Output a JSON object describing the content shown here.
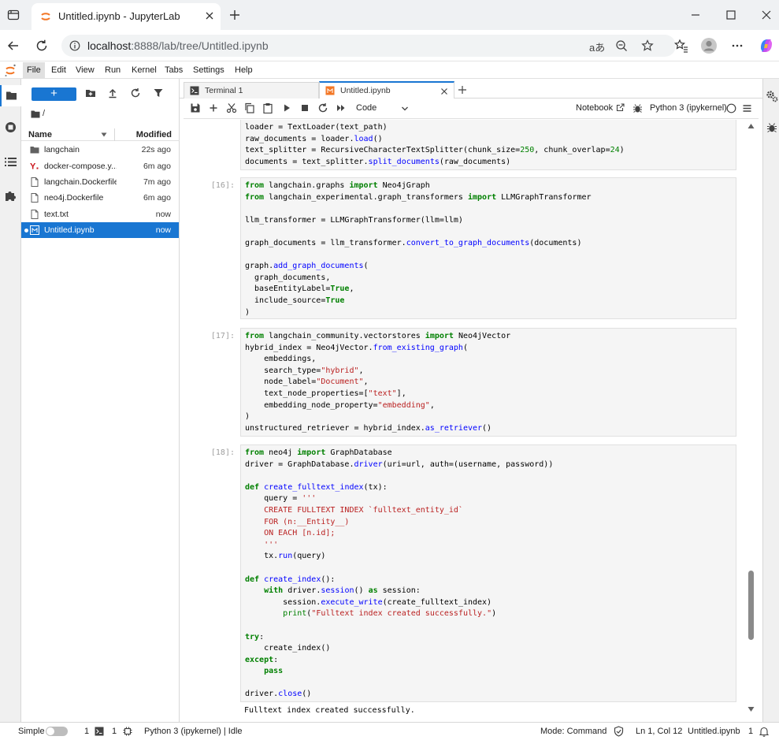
{
  "browser": {
    "tab_title": "Untitled.ipynb - JupyterLab",
    "url_host": "localhost",
    "url_rest": ":8888/lab/tree/Untitled.ipynb"
  },
  "menubar": [
    "File",
    "Edit",
    "View",
    "Run",
    "Kernel",
    "Tabs",
    "Settings",
    "Help"
  ],
  "filebrowser": {
    "new_label": "+",
    "breadcrumb": "/",
    "col_name": "Name",
    "col_modified": "Modified",
    "files": [
      {
        "name": "langchain",
        "modified": "22s ago",
        "icon": "folder-icon"
      },
      {
        "name": "docker-compose.yml",
        "name_display": "docker-compose.y...",
        "modified": "6m ago",
        "icon": "yaml-icon"
      },
      {
        "name": "langchain.Dockerfile",
        "modified": "7m ago",
        "icon": "file-icon"
      },
      {
        "name": "neo4j.Dockerfile",
        "modified": "6m ago",
        "icon": "file-icon"
      },
      {
        "name": "text.txt",
        "modified": "now",
        "icon": "file-icon"
      },
      {
        "name": "Untitled.ipynb",
        "modified": "now",
        "icon": "notebook-icon",
        "selected": true
      }
    ]
  },
  "tabs": {
    "terminal": "Terminal 1",
    "notebook": "Untitled.ipynb"
  },
  "toolbar": {
    "cell_type": "Code",
    "notebook_link": "Notebook",
    "kernel": "Python 3 (ipykernel)"
  },
  "cells": {
    "c15": {
      "lines": [
        "loader = TextLoader(text_path)",
        "raw_documents = loader.load()",
        "text_splitter = RecursiveCharacterTextSplitter(chunk_size=250, chunk_overlap=24)",
        "documents = text_splitter.split_documents(raw_documents)"
      ]
    },
    "c16": {
      "prompt": "[16]:"
    },
    "c17": {
      "prompt": "[17]:"
    },
    "c18": {
      "prompt": "[18]:",
      "output": "Fulltext index created successfully."
    }
  },
  "statusbar": {
    "mode_simple": "Simple",
    "count1": "1",
    "count2": "1",
    "kernel_status": "Python 3 (ipykernel) | Idle",
    "mode": "Mode: Command",
    "position": "Ln 1, Col 12",
    "file": "Untitled.ipynb",
    "tail": "1"
  },
  "colors": {
    "accent": "#1976d2",
    "keyword": "#008000",
    "string": "#ba2121",
    "function": "#0000ff"
  }
}
